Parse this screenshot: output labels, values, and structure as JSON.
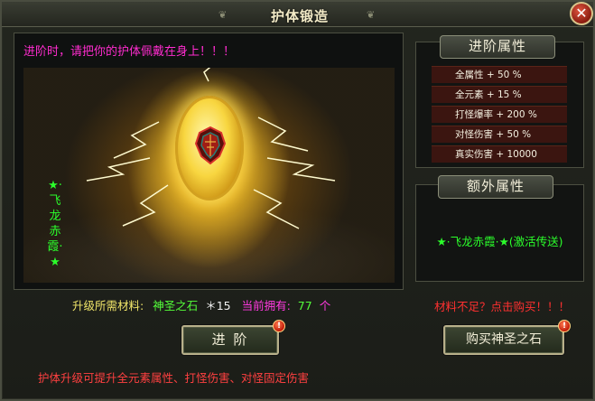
{
  "window": {
    "title": "护体锻造",
    "close_glyph": "✕"
  },
  "warning": "进阶时，请把你的护体佩戴在身上！！！",
  "item": {
    "side_name": "★·飞龙赤霞·★"
  },
  "materials": {
    "label": "升级所需材料:",
    "item_name": "神圣之石",
    "qty": "＊15",
    "have_label": "当前拥有:",
    "have_value": "77",
    "unit": "个"
  },
  "buttons": {
    "advance": "进 阶",
    "buy": "购买神圣之石",
    "alert_glyph": "!"
  },
  "footer": "护体升级可提升全元素属性、打怪伤害、对怪固定伤害",
  "advance_attributes": {
    "header": "进阶属性",
    "rows": [
      "全属性 + 50 %",
      "全元素 + 15 %",
      "打怪爆率 + 200 %",
      "对怪伤害 + 50 %",
      "真实伤害 + 10000"
    ]
  },
  "extra_attributes": {
    "header": "额外属性",
    "text": "★·飞龙赤霞·★(激活传送)"
  },
  "shortage": "材料不足？点击购买！！！",
  "colors": {
    "warning": "#ff2ccf",
    "green": "#2bff2b",
    "yellow": "#f2e76a",
    "magenta": "#ff3ae0",
    "red": "#ff3030"
  }
}
